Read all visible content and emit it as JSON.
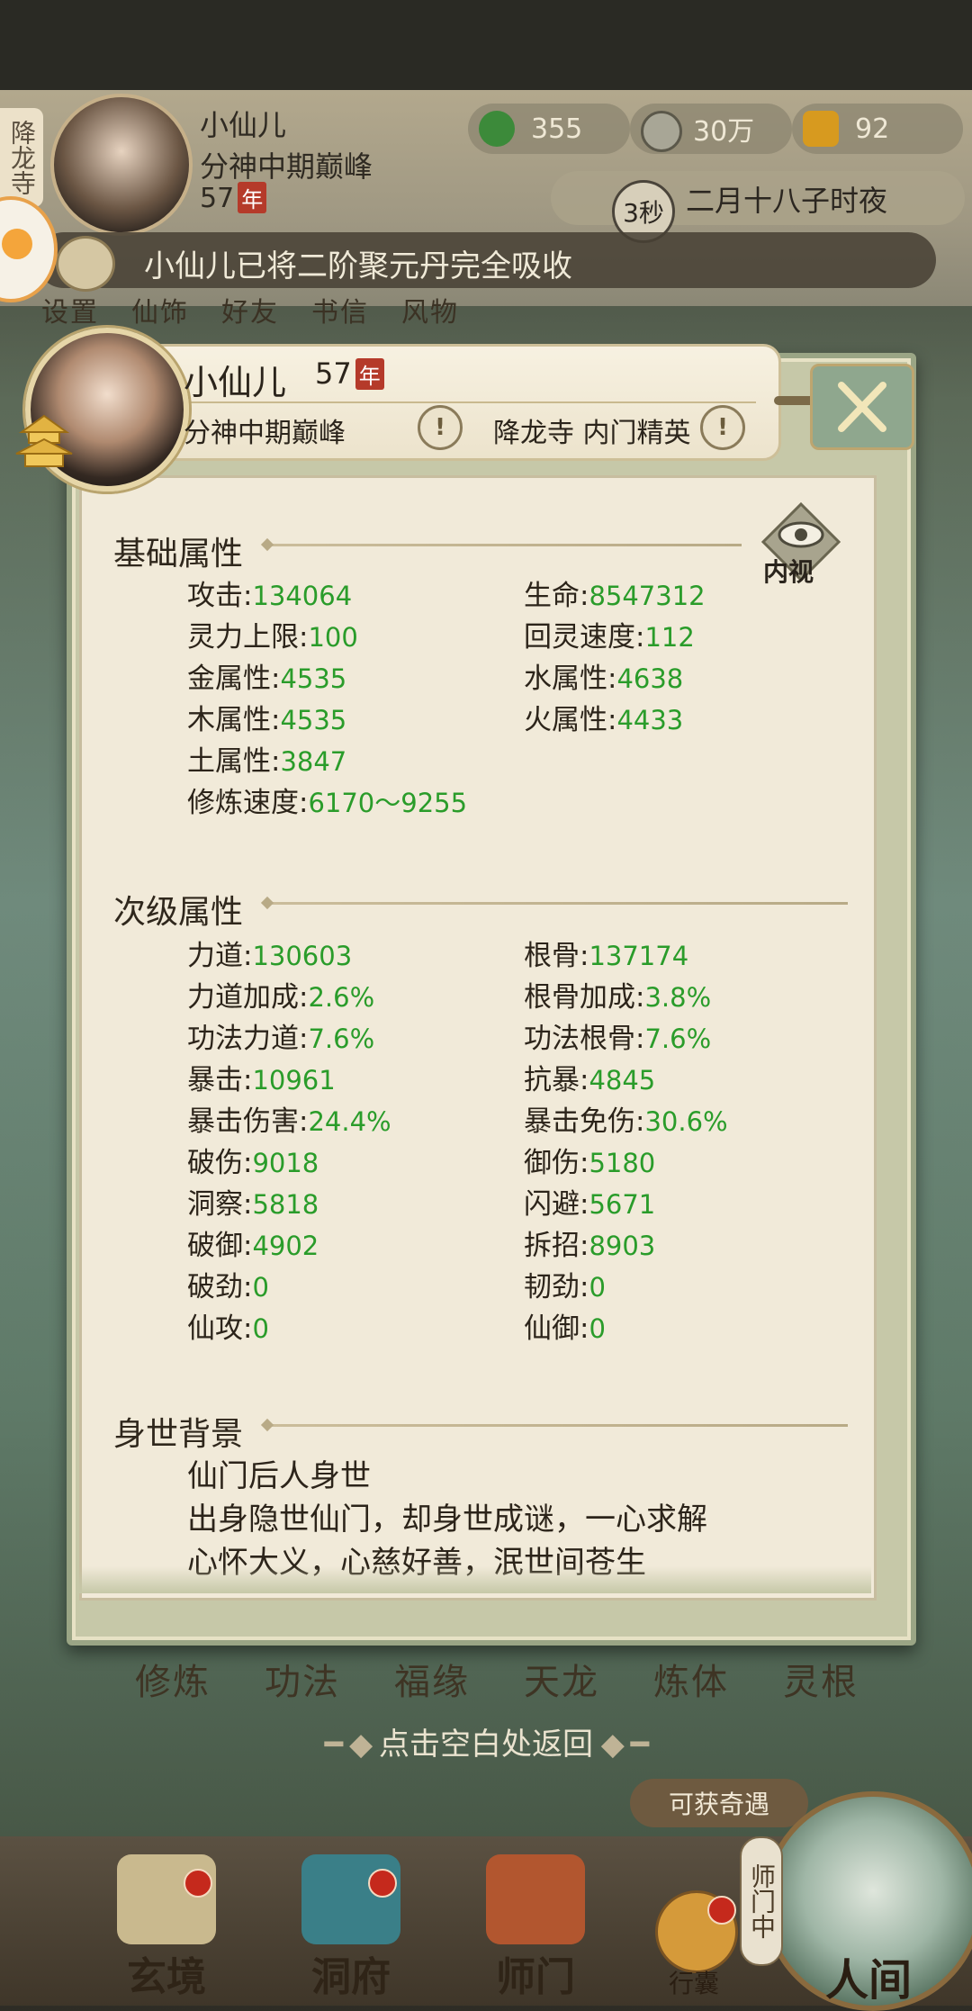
{
  "hud": {
    "sect_tag": "降龙寺",
    "name": "小仙儿",
    "realm": "分神中期巅峰",
    "age": "57",
    "age_unit": "年",
    "resources": [
      {
        "icon": "jade-leaf-icon",
        "value": "355"
      },
      {
        "icon": "coin-icon",
        "value": "30万"
      },
      {
        "icon": "gold-ingot-icon",
        "value": "92"
      }
    ],
    "timer": "3秒",
    "date": "二月十八子时夜",
    "notice": "小仙儿已将二阶聚元丹完全吸收",
    "menu": [
      "设置",
      "仙饰",
      "好友",
      "书信",
      "风物"
    ]
  },
  "profile": {
    "name": "小仙儿",
    "age": "57",
    "age_unit": "年",
    "realm": "分神中期巅峰",
    "sect": "降龙寺 内门精英",
    "inner_view_label": "内视"
  },
  "basic": {
    "title": "基础属性",
    "items": [
      {
        "label": "攻击",
        "value": "134064"
      },
      {
        "label": "生命",
        "value": "8547312"
      },
      {
        "label": "灵力上限",
        "value": "100"
      },
      {
        "label": "回灵速度",
        "value": "112"
      },
      {
        "label": "金属性",
        "value": "4535"
      },
      {
        "label": "水属性",
        "value": "4638"
      },
      {
        "label": "木属性",
        "value": "4535"
      },
      {
        "label": "火属性",
        "value": "4433"
      },
      {
        "label": "土属性",
        "value": "3847"
      },
      {
        "label": "修炼速度",
        "value": "6170～9255"
      }
    ]
  },
  "secondary": {
    "title": "次级属性",
    "items": [
      {
        "label": "力道",
        "value": "130603"
      },
      {
        "label": "根骨",
        "value": "137174"
      },
      {
        "label": "力道加成",
        "value": "2.6%"
      },
      {
        "label": "根骨加成",
        "value": "3.8%"
      },
      {
        "label": "功法力道",
        "value": "7.6%"
      },
      {
        "label": "功法根骨",
        "value": "7.6%"
      },
      {
        "label": "暴击",
        "value": "10961"
      },
      {
        "label": "抗暴",
        "value": "4845"
      },
      {
        "label": "暴击伤害",
        "value": "24.4%"
      },
      {
        "label": "暴击免伤",
        "value": "30.6%"
      },
      {
        "label": "破伤",
        "value": "9018"
      },
      {
        "label": "御伤",
        "value": "5180"
      },
      {
        "label": "洞察",
        "value": "5818"
      },
      {
        "label": "闪避",
        "value": "5671"
      },
      {
        "label": "破御",
        "value": "4902"
      },
      {
        "label": "拆招",
        "value": "8903"
      },
      {
        "label": "破劲",
        "value": "0"
      },
      {
        "label": "韧劲",
        "value": "0"
      },
      {
        "label": "仙攻",
        "value": "0"
      },
      {
        "label": "仙御",
        "value": "0"
      }
    ]
  },
  "background": {
    "title": "身世背景",
    "lines": [
      "仙门后人身世",
      "出身隐世仙门，却身世成谜，一心求解",
      "心怀大义，心慈好善，泯世间苍生"
    ]
  },
  "bottom": {
    "skill_tabs": [
      "修炼",
      "功法",
      "福缘",
      "天龙",
      "炼体",
      "灵根"
    ],
    "back_hint": "点击空白处返回",
    "encounter": "可获奇遇",
    "shimen_tag": "师门中",
    "nav": [
      "玄境",
      "洞府",
      "师门"
    ],
    "bag": "行囊",
    "world": "人间"
  }
}
